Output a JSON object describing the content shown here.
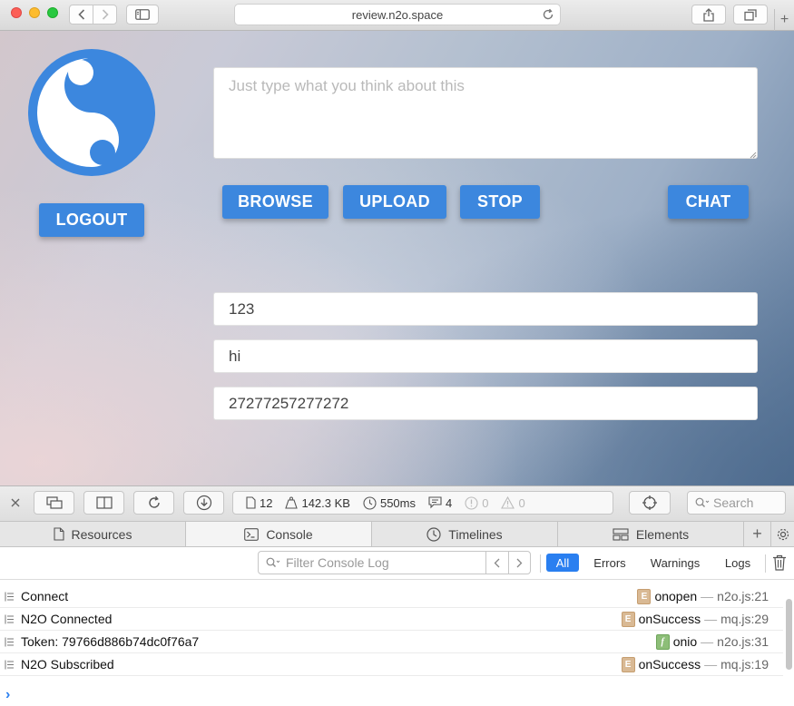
{
  "browser": {
    "address": "review.n2o.space"
  },
  "app": {
    "logout_label": "LOGOUT",
    "composer_placeholder": "Just type what you think about this",
    "buttons": {
      "browse": "BROWSE",
      "upload": "UPLOAD",
      "stop": "STOP",
      "chat": "CHAT"
    },
    "messages": [
      "123",
      "hi",
      "27277257277272"
    ],
    "accent_color": "#3c87de"
  },
  "devtools": {
    "stats": {
      "resources": "12",
      "size": "142.3 KB",
      "time": "550ms",
      "logs": "4",
      "errors": "0",
      "warnings": "0"
    },
    "search_placeholder": "Search",
    "tabs": [
      "Resources",
      "Console",
      "Timelines",
      "Elements"
    ],
    "active_tab": "Console",
    "filter_placeholder": "Filter Console Log",
    "levels": [
      "All",
      "Errors",
      "Warnings",
      "Logs"
    ],
    "active_level": "All",
    "log": [
      {
        "text": "Connect",
        "badge": "E",
        "fn": "onopen",
        "loc": "n2o.js:21"
      },
      {
        "text": "N2O Connected",
        "badge": "E",
        "fn": "onSuccess",
        "loc": "mq.js:29"
      },
      {
        "text": "Token: 79766d886b74dc0f76a7",
        "badge": "f",
        "fn": "onio",
        "loc": "n2o.js:31"
      },
      {
        "text": "N2O Subscribed",
        "badge": "E",
        "fn": "onSuccess",
        "loc": "mq.js:19"
      }
    ],
    "prompt": "›",
    "dash": "—"
  }
}
